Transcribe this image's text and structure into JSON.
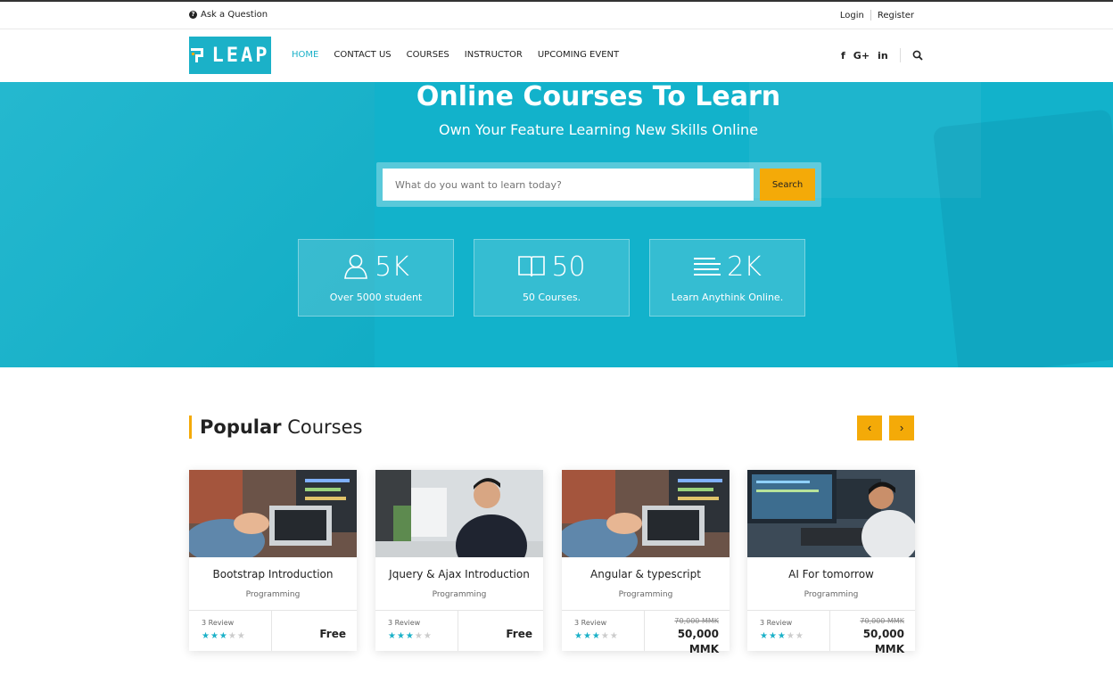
{
  "topbar": {
    "ask": "Ask a Question",
    "login": "Login",
    "register": "Register"
  },
  "header": {
    "logo": "LEAP",
    "nav": [
      "HOME",
      "CONTACT US",
      "COURSES",
      "INSTRUCTOR",
      "UPCOMING EVENT"
    ],
    "active_nav": "HOME",
    "social": [
      "f",
      "G+",
      "in"
    ]
  },
  "hero": {
    "title": "Online Courses To Learn",
    "subtitle": "Own Your Feature Learning New Skills Online",
    "search_placeholder": "What do you want to learn today?",
    "search_button": "Search",
    "stats": [
      {
        "value": "5K",
        "label": "Over 5000 student",
        "icon": "user-icon"
      },
      {
        "value": "50",
        "label": "50 Courses.",
        "icon": "book-icon"
      },
      {
        "value": "2K",
        "label": "Learn Anythink Online.",
        "icon": "lines-icon"
      }
    ]
  },
  "popular": {
    "title_bold": "Popular",
    "title_rest": " Courses",
    "cards": [
      {
        "title": "Bootstrap Introduction",
        "category": "Programming",
        "reviews": "3 Review",
        "stars": 3,
        "old_price": "",
        "price": "Free"
      },
      {
        "title": "Jquery & Ajax Introduction",
        "category": "Programming",
        "reviews": "3 Review",
        "stars": 3,
        "old_price": "",
        "price": "Free"
      },
      {
        "title": "Angular & typescript",
        "category": "Programming",
        "reviews": "3 Review",
        "stars": 3,
        "old_price": "70,000 MMK",
        "price": "50,000 MMK"
      },
      {
        "title": "AI For tomorrow",
        "category": "Programming",
        "reviews": "3 Review",
        "stars": 3,
        "old_price": "70,000 MMK",
        "price": "50,000 MMK"
      }
    ]
  },
  "colors": {
    "accent": "#1bb1c8",
    "button": "#f4aa08"
  }
}
